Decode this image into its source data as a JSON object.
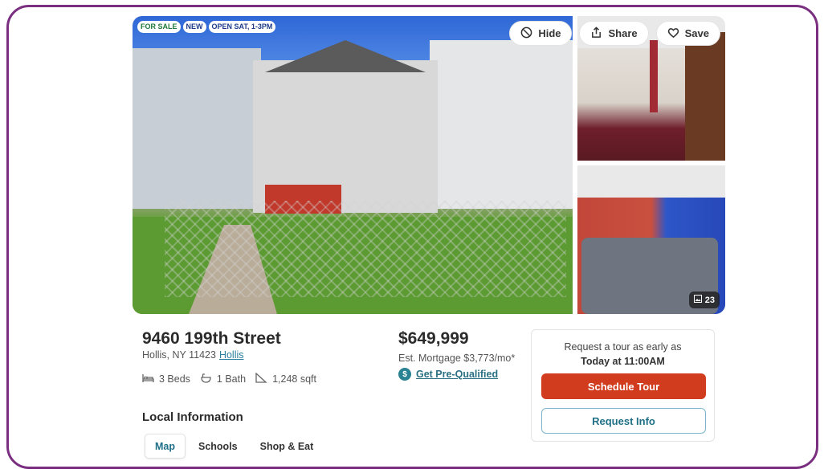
{
  "badges": [
    "FOR SALE",
    "NEW",
    "OPEN SAT, 1-3PM"
  ],
  "actions": {
    "hide": "Hide",
    "share": "Share",
    "save": "Save"
  },
  "photos": {
    "count": "23"
  },
  "listing": {
    "address": "9460 199th Street",
    "city_state_zip": "Hollis, NY 11423",
    "neighborhood": "Hollis",
    "beds": "3 Beds",
    "baths": "1 Bath",
    "sqft": "1,248 sqft",
    "price": "$649,999",
    "mortgage": "Est. Mortgage $3,773/mo*",
    "prequalified": "Get Pre-Qualified"
  },
  "tour": {
    "line1": "Request a tour as early as",
    "line2": "Today at 11:00AM",
    "schedule": "Schedule Tour",
    "request_info": "Request Info"
  },
  "local": {
    "title": "Local Information",
    "tabs": [
      "Map",
      "Schools",
      "Shop & Eat"
    ]
  },
  "colors": {
    "frame": "#7a2f80",
    "schedule_button": "#d23c1e",
    "link": "#2a7f9e"
  }
}
